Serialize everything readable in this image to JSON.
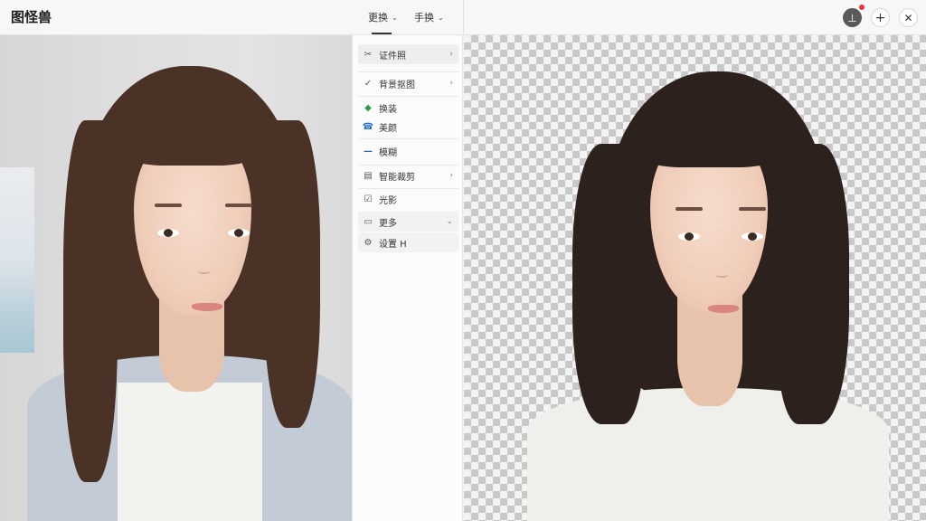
{
  "app": {
    "title": "图怪兽"
  },
  "topbar": {
    "menus": [
      {
        "label": "更换",
        "icon": "chevron-down-icon"
      },
      {
        "label": "手换",
        "icon": "chevron-down-icon"
      }
    ],
    "buttons": [
      {
        "name": "pin",
        "icon": "pin-icon",
        "badge": "notification-dot",
        "badge_color": "#e53935"
      },
      {
        "name": "add",
        "icon": "plus-icon"
      },
      {
        "name": "close",
        "icon": "close-icon"
      }
    ]
  },
  "panel": {
    "items": [
      {
        "label": "证件照",
        "icon": "scissors-icon",
        "arrow": "›",
        "active": true
      },
      {
        "label": "背景抠图",
        "icon": "check-icon",
        "arrow": "›"
      },
      {
        "label": "换装",
        "icon": "pin-icon"
      },
      {
        "label": "美颜",
        "icon": "phone-icon"
      },
      {
        "label": "模糊",
        "icon": "dash-icon"
      },
      {
        "label": "智能裁剪",
        "icon": "card-icon",
        "arrow": "›"
      },
      {
        "label": "光影",
        "icon": "checkbox-icon"
      },
      {
        "label": "更多",
        "icon": "folder-icon",
        "arrow": "⌄"
      },
      {
        "label": "设置 H",
        "icon": "gear-icon"
      }
    ]
  },
  "colors": {
    "checker_dark": "#c9c9c9",
    "checker_light": "#f4f4f4",
    "active_item": "#eeeeee"
  }
}
